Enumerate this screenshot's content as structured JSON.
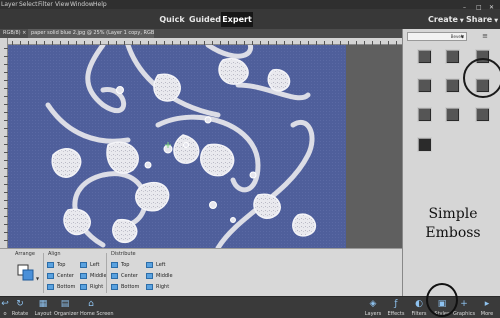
{
  "menu": [
    "Layer",
    "Select",
    "Filter",
    "View",
    "Window",
    "Help"
  ],
  "modes": {
    "quick": "Quick",
    "guided": "Guided",
    "expert": "Expert"
  },
  "create": "Create",
  "share": "Share",
  "window_controls": [
    "–",
    "□",
    "✕"
  ],
  "doc_tabs": [
    {
      "label": "RGB/8) ×"
    },
    {
      "label": "paper solid blue 2.jpg @ 25% (Layer 1 copy, RGB/8) *  ×"
    }
  ],
  "options_panel": {
    "arrange": "Arrange",
    "align": "Align",
    "distribute": "Distribute",
    "align_items": [
      "Top",
      "Left",
      "Center",
      "Middle",
      "Bottom",
      "Right"
    ],
    "distribute_items": [
      "Top",
      "Left",
      "Center",
      "Middle",
      "Bottom",
      "Right"
    ]
  },
  "right_panel": {
    "dropdown": "Bevels",
    "caption_line1": "Simple",
    "caption_line2": "Emboss",
    "more": "≡"
  },
  "bottom_left": [
    {
      "icon": "arrow-icon",
      "label": "o"
    },
    {
      "icon": "rotate-icon",
      "label": "Rotate"
    },
    {
      "icon": "layout-icon",
      "label": "Layout"
    },
    {
      "icon": "organizer-icon",
      "label": "Organizer"
    },
    {
      "icon": "home-icon",
      "label": "Home Screen"
    }
  ],
  "bottom_right": [
    {
      "icon": "layers-icon",
      "label": "Layers"
    },
    {
      "icon": "effects-icon",
      "label": "Effects"
    },
    {
      "icon": "filters-icon",
      "label": "Filters"
    },
    {
      "icon": "styles-icon",
      "label": "Styles"
    },
    {
      "icon": "graphics-icon",
      "label": "Graphics"
    },
    {
      "icon": "more-icon",
      "label": "More"
    }
  ],
  "colors": {
    "canvas": "#4f5f9b",
    "accent": "#8fc3f0",
    "menubar": "#2f2f2f"
  }
}
